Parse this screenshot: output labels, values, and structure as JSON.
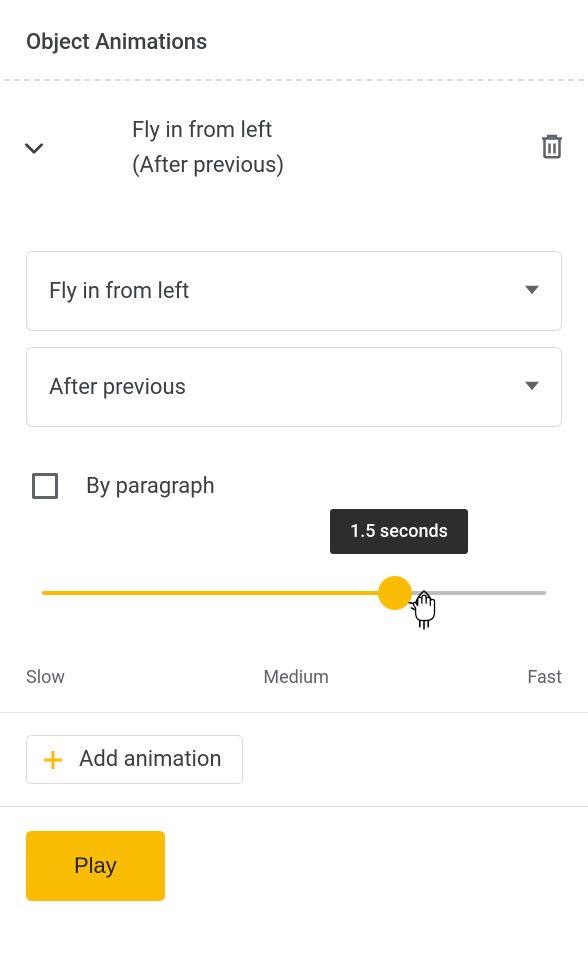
{
  "panel": {
    "title": "Object Animations"
  },
  "animation": {
    "header_title": "Fly in from left",
    "header_sub": "(After previous)",
    "type_selected": "Fly in from left",
    "start_selected": "After previous",
    "by_paragraph_label": "By paragraph"
  },
  "slider": {
    "tooltip": "1.5 seconds",
    "label_slow": "Slow",
    "label_medium": "Medium",
    "label_fast": "Fast"
  },
  "buttons": {
    "add": "Add animation",
    "play": "Play"
  }
}
